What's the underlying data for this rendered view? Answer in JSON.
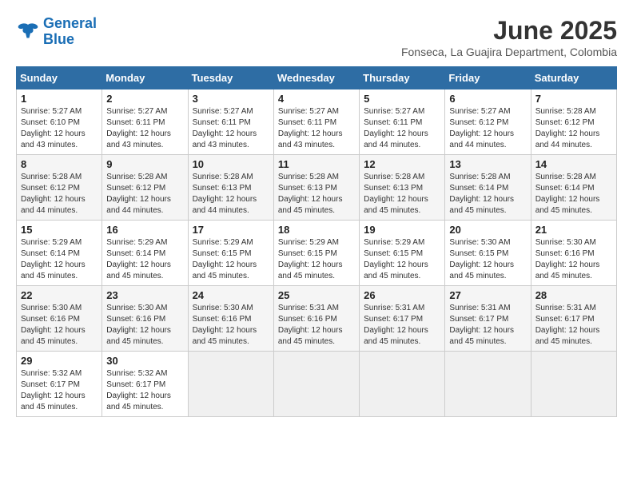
{
  "header": {
    "logo_line1": "General",
    "logo_line2": "Blue",
    "month_title": "June 2025",
    "location": "Fonseca, La Guajira Department, Colombia"
  },
  "weekdays": [
    "Sunday",
    "Monday",
    "Tuesday",
    "Wednesday",
    "Thursday",
    "Friday",
    "Saturday"
  ],
  "weeks": [
    [
      {
        "day": "1",
        "sunrise": "5:27 AM",
        "sunset": "6:10 PM",
        "daylight": "12 hours and 43 minutes."
      },
      {
        "day": "2",
        "sunrise": "5:27 AM",
        "sunset": "6:11 PM",
        "daylight": "12 hours and 43 minutes."
      },
      {
        "day": "3",
        "sunrise": "5:27 AM",
        "sunset": "6:11 PM",
        "daylight": "12 hours and 43 minutes."
      },
      {
        "day": "4",
        "sunrise": "5:27 AM",
        "sunset": "6:11 PM",
        "daylight": "12 hours and 43 minutes."
      },
      {
        "day": "5",
        "sunrise": "5:27 AM",
        "sunset": "6:11 PM",
        "daylight": "12 hours and 44 minutes."
      },
      {
        "day": "6",
        "sunrise": "5:27 AM",
        "sunset": "6:12 PM",
        "daylight": "12 hours and 44 minutes."
      },
      {
        "day": "7",
        "sunrise": "5:28 AM",
        "sunset": "6:12 PM",
        "daylight": "12 hours and 44 minutes."
      }
    ],
    [
      {
        "day": "8",
        "sunrise": "5:28 AM",
        "sunset": "6:12 PM",
        "daylight": "12 hours and 44 minutes."
      },
      {
        "day": "9",
        "sunrise": "5:28 AM",
        "sunset": "6:12 PM",
        "daylight": "12 hours and 44 minutes."
      },
      {
        "day": "10",
        "sunrise": "5:28 AM",
        "sunset": "6:13 PM",
        "daylight": "12 hours and 44 minutes."
      },
      {
        "day": "11",
        "sunrise": "5:28 AM",
        "sunset": "6:13 PM",
        "daylight": "12 hours and 45 minutes."
      },
      {
        "day": "12",
        "sunrise": "5:28 AM",
        "sunset": "6:13 PM",
        "daylight": "12 hours and 45 minutes."
      },
      {
        "day": "13",
        "sunrise": "5:28 AM",
        "sunset": "6:14 PM",
        "daylight": "12 hours and 45 minutes."
      },
      {
        "day": "14",
        "sunrise": "5:28 AM",
        "sunset": "6:14 PM",
        "daylight": "12 hours and 45 minutes."
      }
    ],
    [
      {
        "day": "15",
        "sunrise": "5:29 AM",
        "sunset": "6:14 PM",
        "daylight": "12 hours and 45 minutes."
      },
      {
        "day": "16",
        "sunrise": "5:29 AM",
        "sunset": "6:14 PM",
        "daylight": "12 hours and 45 minutes."
      },
      {
        "day": "17",
        "sunrise": "5:29 AM",
        "sunset": "6:15 PM",
        "daylight": "12 hours and 45 minutes."
      },
      {
        "day": "18",
        "sunrise": "5:29 AM",
        "sunset": "6:15 PM",
        "daylight": "12 hours and 45 minutes."
      },
      {
        "day": "19",
        "sunrise": "5:29 AM",
        "sunset": "6:15 PM",
        "daylight": "12 hours and 45 minutes."
      },
      {
        "day": "20",
        "sunrise": "5:30 AM",
        "sunset": "6:15 PM",
        "daylight": "12 hours and 45 minutes."
      },
      {
        "day": "21",
        "sunrise": "5:30 AM",
        "sunset": "6:16 PM",
        "daylight": "12 hours and 45 minutes."
      }
    ],
    [
      {
        "day": "22",
        "sunrise": "5:30 AM",
        "sunset": "6:16 PM",
        "daylight": "12 hours and 45 minutes."
      },
      {
        "day": "23",
        "sunrise": "5:30 AM",
        "sunset": "6:16 PM",
        "daylight": "12 hours and 45 minutes."
      },
      {
        "day": "24",
        "sunrise": "5:30 AM",
        "sunset": "6:16 PM",
        "daylight": "12 hours and 45 minutes."
      },
      {
        "day": "25",
        "sunrise": "5:31 AM",
        "sunset": "6:16 PM",
        "daylight": "12 hours and 45 minutes."
      },
      {
        "day": "26",
        "sunrise": "5:31 AM",
        "sunset": "6:17 PM",
        "daylight": "12 hours and 45 minutes."
      },
      {
        "day": "27",
        "sunrise": "5:31 AM",
        "sunset": "6:17 PM",
        "daylight": "12 hours and 45 minutes."
      },
      {
        "day": "28",
        "sunrise": "5:31 AM",
        "sunset": "6:17 PM",
        "daylight": "12 hours and 45 minutes."
      }
    ],
    [
      {
        "day": "29",
        "sunrise": "5:32 AM",
        "sunset": "6:17 PM",
        "daylight": "12 hours and 45 minutes."
      },
      {
        "day": "30",
        "sunrise": "5:32 AM",
        "sunset": "6:17 PM",
        "daylight": "12 hours and 45 minutes."
      },
      null,
      null,
      null,
      null,
      null
    ]
  ]
}
